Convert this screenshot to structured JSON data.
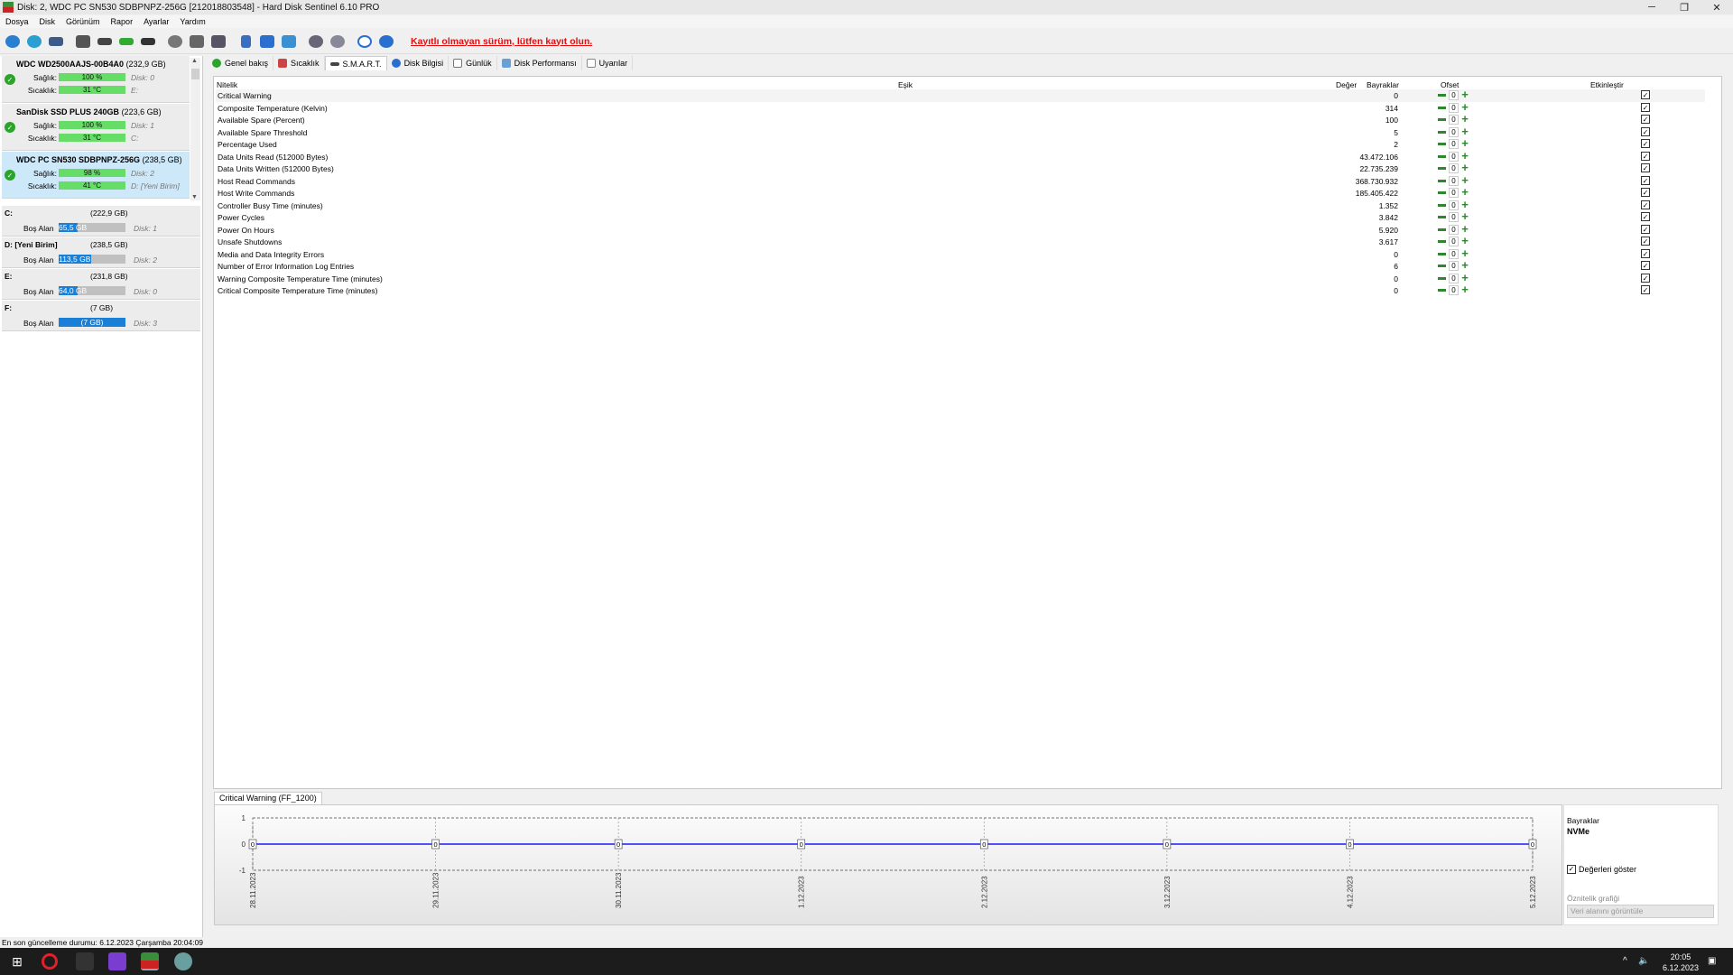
{
  "window": {
    "title": "Disk: 2, WDC PC SN530 SDBPNPZ-256G [212018803548]  -  Hard Disk Sentinel 6.10 PRO"
  },
  "menu": [
    "Dosya",
    "Disk",
    "Görünüm",
    "Rapor",
    "Ayarlar",
    "Yardım"
  ],
  "toolbar": {
    "register_notice": "Kayıtlı olmayan sürüm, lütfen kayıt olun."
  },
  "disks": [
    {
      "name": "WDC WD2500AAJS-00B4A0",
      "size": "(232,9 GB)",
      "health_label": "Sağlık:",
      "health": "100 %",
      "health_pct": 100,
      "disk_ref": "Disk: 0",
      "temp_label": "Sıcaklık:",
      "temp": "31 °C",
      "volumes": "E:"
    },
    {
      "name": "SanDisk SSD PLUS 240GB",
      "size": "(223,6 GB)",
      "health_label": "Sağlık:",
      "health": "100 %",
      "health_pct": 100,
      "disk_ref": "Disk: 1",
      "temp_label": "Sıcaklık:",
      "temp": "31 °C",
      "volumes": "C:"
    },
    {
      "name": "WDC PC SN530 SDBPNPZ-256G",
      "size": "(238,5 GB)",
      "health_label": "Sağlık:",
      "health": "98 %",
      "health_pct": 98,
      "disk_ref": "Disk: 2",
      "temp_label": "Sıcaklık:",
      "temp": "41 °C",
      "volumes": "D: [Yeni Birim]"
    }
  ],
  "volumes": [
    {
      "name": "C:",
      "size": "(222,9 GB)",
      "free_label": "Boş Alan",
      "free": "65,5 GB",
      "free_pct": 29,
      "disk_ref": "Disk: 1"
    },
    {
      "name": "D: [Yeni Birim]",
      "size": "(238,5 GB)",
      "free_label": "Boş Alan",
      "free": "113,5 GB",
      "free_pct": 48,
      "disk_ref": "Disk: 2"
    },
    {
      "name": "E:",
      "size": "(231,8 GB)",
      "free_label": "Boş Alan",
      "free": "64,0 GB",
      "free_pct": 28,
      "disk_ref": "Disk: 0"
    },
    {
      "name": "F:",
      "size": "(7 GB)",
      "free_label": "Boş Alan",
      "free": "(7 GB)",
      "free_pct": 100,
      "disk_ref": "Disk: 3"
    }
  ],
  "tabs": [
    "Genel bakış",
    "Sıcaklık",
    "S.M.A.R.T.",
    "Disk Bilgisi",
    "Günlük",
    "Disk Performansı",
    "Uyarılar"
  ],
  "smart": {
    "columns": {
      "attr": "Nitelik",
      "threshold": "Eşik",
      "value": "Değer",
      "flags": "Bayraklar",
      "offset": "Ofset",
      "enable": "Etkinleştir"
    },
    "rows": [
      {
        "name": "Critical Warning",
        "value": "0",
        "offset": "0"
      },
      {
        "name": "Composite Temperature (Kelvin)",
        "value": "314",
        "offset": "0"
      },
      {
        "name": "Available Spare (Percent)",
        "value": "100",
        "offset": "0"
      },
      {
        "name": "Available Spare Threshold",
        "value": "5",
        "offset": "0"
      },
      {
        "name": "Percentage Used",
        "value": "2",
        "offset": "0"
      },
      {
        "name": "Data Units Read (512000 Bytes)",
        "value": "43.472.106",
        "offset": "0"
      },
      {
        "name": "Data Units Written (512000 Bytes)",
        "value": "22.735.239",
        "offset": "0"
      },
      {
        "name": "Host Read Commands",
        "value": "368.730.932",
        "offset": "0"
      },
      {
        "name": "Host Write Commands",
        "value": "185.405.422",
        "offset": "0"
      },
      {
        "name": "Controller Busy Time (minutes)",
        "value": "1.352",
        "offset": "0"
      },
      {
        "name": "Power Cycles",
        "value": "3.842",
        "offset": "0"
      },
      {
        "name": "Power On Hours",
        "value": "5.920",
        "offset": "0"
      },
      {
        "name": "Unsafe Shutdowns",
        "value": "3.617",
        "offset": "0"
      },
      {
        "name": "Media and Data Integrity Errors",
        "value": "0",
        "offset": "0"
      },
      {
        "name": "Number of Error Information Log Entries",
        "value": "6",
        "offset": "0"
      },
      {
        "name": "Warning Composite Temperature Time (minutes)",
        "value": "0",
        "offset": "0"
      },
      {
        "name": "Critical Composite Temperature Time (minutes)",
        "value": "0",
        "offset": "0"
      }
    ]
  },
  "graph": {
    "tab_label": "Critical Warning (FF_1200)",
    "flags_heading": "Bayraklar",
    "flags_value": "NVMe",
    "show_values_label": "Değerleri göster",
    "attr_graph_label": "Öznitelik grafiği",
    "select_placeholder": "Veri alanını görüntüle"
  },
  "chart_data": {
    "type": "line",
    "x": [
      "28.11.2023",
      "29.11.2023",
      "30.11.2023",
      "1.12.2023",
      "2.12.2023",
      "3.12.2023",
      "4.12.2023",
      "5.12.2023"
    ],
    "series": [
      {
        "values": [
          0,
          0,
          0,
          0,
          0,
          0,
          0,
          0
        ]
      }
    ],
    "ylim": [
      -1,
      1
    ],
    "yticks": [
      "1",
      "0",
      "-1"
    ],
    "grid": true,
    "line_color": "#1a1aff"
  },
  "status": {
    "text": "En son güncelleme durumu: 6.12.2023 Çarşamba 20:04:09"
  },
  "taskbar": {
    "time": "20:05",
    "date": "6.12.2023"
  }
}
